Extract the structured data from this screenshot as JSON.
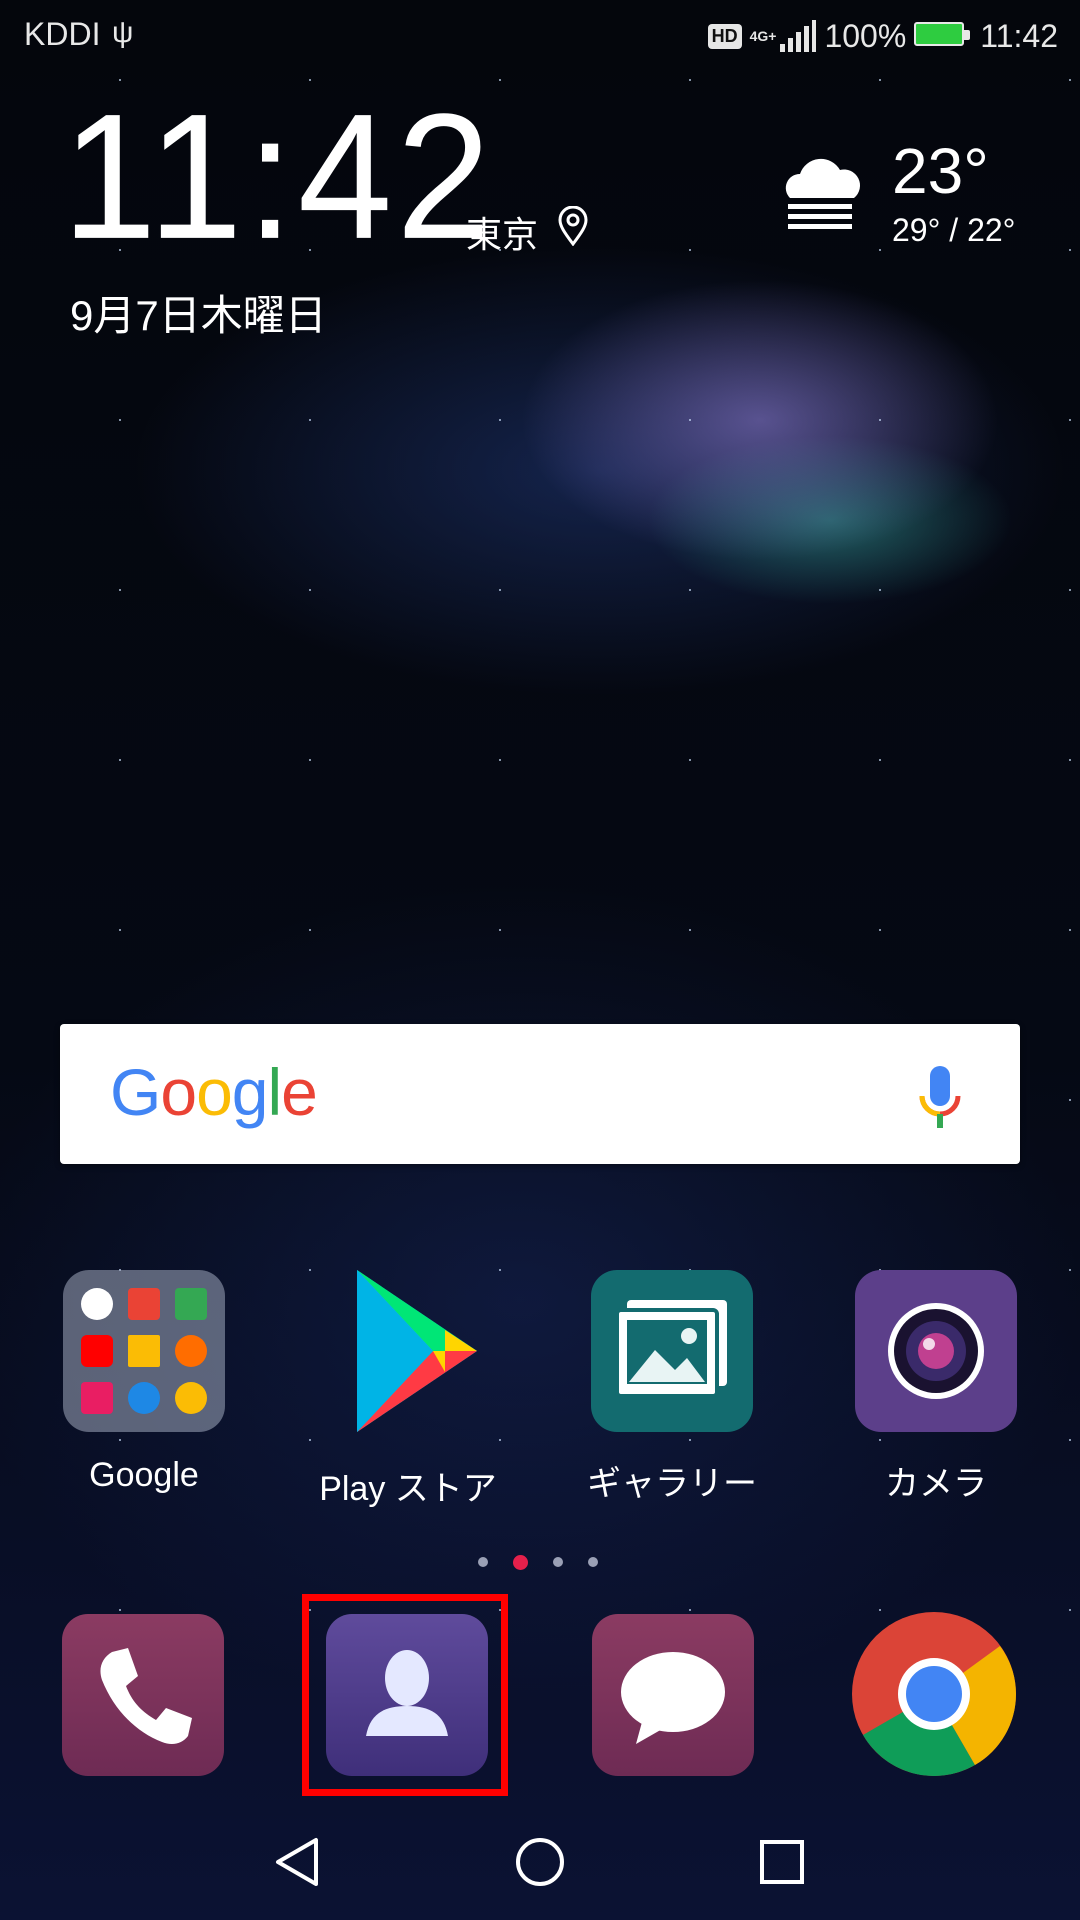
{
  "status_bar": {
    "carrier": "KDDI",
    "hd": "HD",
    "network": "4G+",
    "battery": "100%",
    "time": "11:42"
  },
  "clock_widget": {
    "time": "11:42",
    "city": "東京",
    "date": "9月7日木曜日"
  },
  "weather": {
    "temperature": "23°",
    "range": "29° / 22°",
    "icon": "cloud-icon"
  },
  "search": {
    "logo": "Google",
    "mic_icon": "mic-icon"
  },
  "apps": [
    {
      "label": "Google",
      "icon": "google-folder-icon"
    },
    {
      "label": "Play ストア",
      "icon": "play-store-icon"
    },
    {
      "label": "ギャラリー",
      "icon": "gallery-icon"
    },
    {
      "label": "カメラ",
      "icon": "camera-icon"
    }
  ],
  "page_indicator": {
    "pages": 4,
    "active": 2
  },
  "dock": [
    {
      "app": "phone",
      "icon": "phone-icon"
    },
    {
      "app": "contacts",
      "icon": "contacts-icon",
      "highlighted": true
    },
    {
      "app": "messages",
      "icon": "message-icon"
    },
    {
      "app": "chrome",
      "icon": "chrome-icon"
    }
  ],
  "nav": [
    "back-icon",
    "home-icon",
    "recents-icon"
  ],
  "colors": {
    "highlight": "#ff0000",
    "active_dot": "#e5204b",
    "battery": "#2ecc40"
  }
}
